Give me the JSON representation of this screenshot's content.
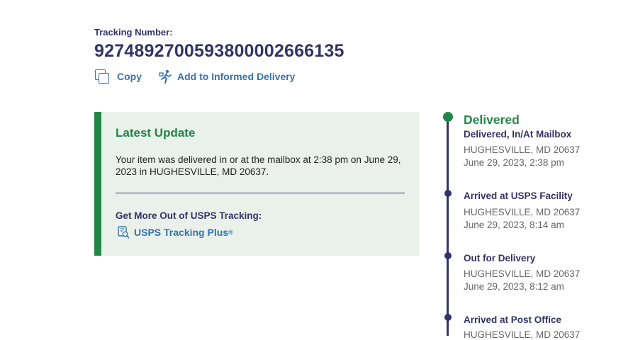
{
  "tracking": {
    "label": "Tracking Number:",
    "number": "9274892700593800002666135",
    "copy_label": "Copy",
    "informed_label": "Add to Informed Delivery"
  },
  "latest_update": {
    "title": "Latest Update",
    "text": "Your item was delivered in or at the mailbox at 2:38 pm on June 29, 2023 in HUGHESVILLE, MD 20637.",
    "more_label": "Get More Out of USPS Tracking:",
    "plus_label": "USPS Tracking Plus",
    "plus_reg": "®"
  },
  "colors": {
    "navy": "#333366",
    "green": "#218748",
    "link_blue": "#3573b1",
    "panel_bg": "#eaf1eb"
  },
  "events": [
    {
      "status": "Delivered",
      "detail": "Delivered, In/At Mailbox",
      "location": "HUGHESVILLE, MD 20637",
      "time": "June 29, 2023, 2:38 pm"
    },
    {
      "status": "Arrived at USPS Facility",
      "location": "HUGHESVILLE, MD 20637",
      "time": "June 29, 2023, 8:14 am"
    },
    {
      "status": "Out for Delivery",
      "location": "HUGHESVILLE, MD 20637",
      "time": "June 29, 2023, 8:12 am"
    },
    {
      "status": "Arrived at Post Office",
      "location": "HUGHESVILLE, MD 20637",
      "time": ""
    }
  ]
}
